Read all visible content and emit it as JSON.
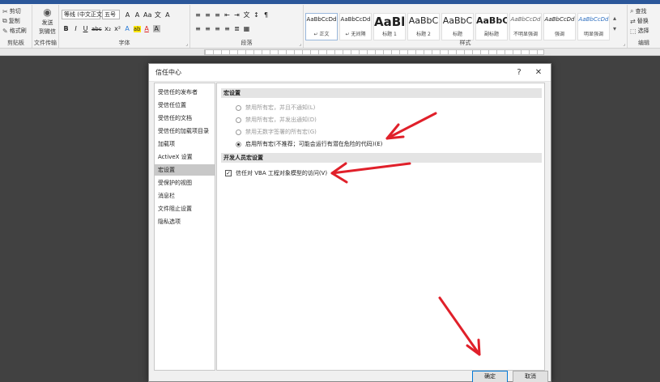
{
  "ribbon": {
    "clipboard": {
      "cut": "剪切",
      "copy": "复制",
      "format_painter": "格式刷",
      "label": "剪贴板"
    },
    "send": {
      "line1": "发送",
      "line2": "到微信",
      "label": "文件传输"
    },
    "font": {
      "font_name": "等线 (中文正文)",
      "font_size": "五号",
      "row1": [
        "A",
        "A",
        "Aa",
        "文",
        "A"
      ],
      "row2": [
        "B",
        "I",
        "U",
        "abc",
        "x₂",
        "x²",
        "A",
        "ab",
        "A",
        "A"
      ],
      "label": "字体"
    },
    "paragraph": {
      "row1": [
        "≡",
        "≡",
        "≡",
        "⇤",
        "⇥",
        "文",
        "↕",
        "¶"
      ],
      "row2": [
        "≡",
        "≡",
        "≡",
        "≡",
        "≣",
        "▦"
      ],
      "label": "段落"
    },
    "styles": {
      "tiles": [
        {
          "preview": "AaBbCcDd",
          "name": "↵ 正文"
        },
        {
          "preview": "AaBbCcDd",
          "name": "↵ 无间隔"
        },
        {
          "preview": "AaBl",
          "name": "标题 1"
        },
        {
          "preview": "AaBbC",
          "name": "标题 2"
        },
        {
          "preview": "AaBbC",
          "name": "标题"
        },
        {
          "preview": "AaBbC",
          "name": "副标题"
        },
        {
          "preview": "AaBbCcDd",
          "name": "不明显强调"
        },
        {
          "preview": "AaBbCcDd",
          "name": "强调"
        },
        {
          "preview": "AaBbCcDd",
          "name": "明显强调"
        }
      ],
      "label": "样式"
    },
    "editing": {
      "find": "查找",
      "replace": "替换",
      "select": "选择",
      "label": "编辑"
    }
  },
  "dialog": {
    "title": "信任中心",
    "help": "?",
    "close": "✕",
    "nav": [
      "受信任的发布者",
      "受信任位置",
      "受信任的文档",
      "受信任的加载项目录",
      "加载项",
      "ActiveX 设置",
      "宏设置",
      "受保护的视图",
      "消息栏",
      "文件阻止设置",
      "隐私选项"
    ],
    "active_nav": 6,
    "macro_section": "宏设置",
    "macro_options": [
      {
        "label": "禁用所有宏，并且不通知(L)",
        "selected": false
      },
      {
        "label": "禁用所有宏，并发出通知(D)",
        "selected": false
      },
      {
        "label": "禁用无数字签署的所有宏(G)",
        "selected": false
      },
      {
        "label": "启用所有宏(不推荐；可能会运行有潜在危险的代码)(E)",
        "selected": true
      }
    ],
    "dev_section": "开发人员宏设置",
    "dev_checkbox": {
      "label": "信任对 VBA 工程对象模型的访问(V)",
      "checked": true
    },
    "ok": "确定",
    "cancel": "取消"
  },
  "colors": {
    "annotation": "#e0202a",
    "ribbon_accent": "#2b579a"
  }
}
